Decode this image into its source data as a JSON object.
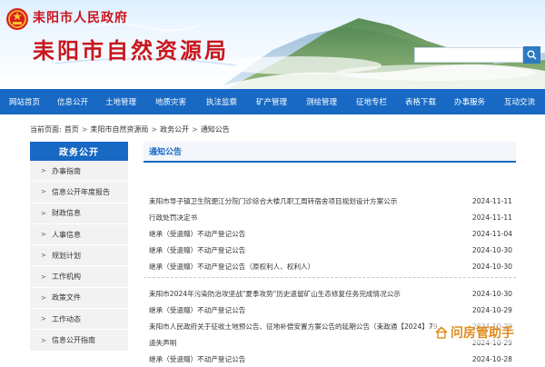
{
  "header": {
    "gov_name": "耒阳市人民政府",
    "bureau_name": "耒阳市自然资源局",
    "search": {
      "placeholder": "",
      "button_icon": "search-icon"
    }
  },
  "colors": {
    "brand_blue": "#1769c4",
    "title_red": "#c8171e",
    "watermark_orange": "#e08a1c"
  },
  "nav": {
    "items": [
      "网站首页",
      "信息公开",
      "土地管理",
      "地质灾害",
      "执法监察",
      "矿产管理",
      "测绘管理",
      "征地专栏",
      "表格下载",
      "办事服务",
      "互动交流"
    ]
  },
  "breadcrumb": {
    "prefix": "当前页面:",
    "items": [
      "首页",
      "耒阳市自然资源局",
      "政务公开",
      "通知公告"
    ],
    "separator": ">"
  },
  "sidebar": {
    "title": "政务公开",
    "items": [
      "办事指南",
      "信息公开年度报告",
      "财政信息",
      "人事信息",
      "规划计划",
      "工作机构",
      "政策文件",
      "工作动态",
      "信息公开指南"
    ]
  },
  "content": {
    "heading": "通知公告",
    "news": [
      {
        "title": "耒阳市导子镇卫生院淝江分院门诊综合大楼几职工周转宿舍项目规划设计方案公示",
        "date": "2024-11-11"
      },
      {
        "title": "行政处罚决定书",
        "date": "2024-11-11"
      },
      {
        "title": "继承（受遗赠）不动产登记公告",
        "date": "2024-11-04"
      },
      {
        "title": "继承（受遗赠）不动产登记公告",
        "date": "2024-10-30"
      },
      {
        "title": "继承（受遗赠）不动产登记公告（原权利人、权利人）",
        "date": "2024-10-30"
      },
      {
        "title": "耒阳市2024年污染防治攻坚战\"夏季攻势\"历史遗留矿山生态修复任务完成情况公示",
        "date": "2024-10-30"
      },
      {
        "title": "继承（受遗赠）不动产登记公告",
        "date": "2024-10-29"
      },
      {
        "title": "耒阳市人民政府关于征收土地预公告、征地补偿安置方案公告的延期公告（耒政通【2024】79...",
        "date": "2024-10-29"
      },
      {
        "title": "遗失声明",
        "date": "2024-10-29"
      },
      {
        "title": "继承（受遗赠）不动产登记公告",
        "date": "2024-10-28"
      }
    ]
  },
  "watermark": {
    "text": "问房管助手",
    "icon": "house-icon"
  }
}
